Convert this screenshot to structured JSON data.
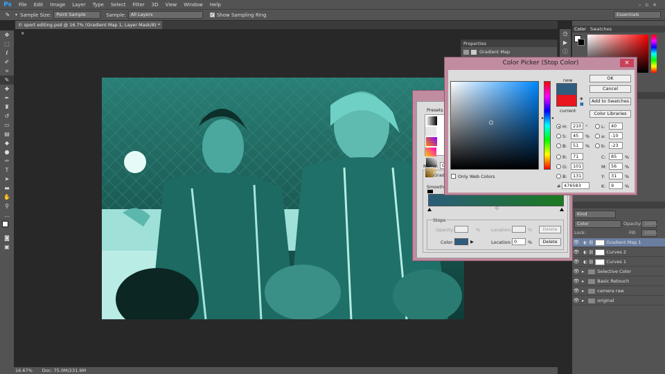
{
  "app": {
    "logo": "Ps"
  },
  "menu": [
    "File",
    "Edit",
    "Image",
    "Layer",
    "Type",
    "Select",
    "Filter",
    "3D",
    "View",
    "Window",
    "Help"
  ],
  "options": {
    "sample_size_label": "Sample Size:",
    "sample_size_value": "Point Sample",
    "sample_label": "Sample:",
    "sample_value": "All Layers",
    "show_ring_label": "Show Sampling Ring",
    "workspace": "Essentials"
  },
  "document": {
    "tab_title": "© sport editing.psd @ 16.7% (Gradient Map 1, Layer Mask/8) *",
    "close": "×"
  },
  "status": {
    "zoom": "16.67%",
    "doc": "Doc: 75.0M/231.9M"
  },
  "properties": {
    "tab": "Properties",
    "title": "Gradient Map"
  },
  "color_panel": {
    "tabs": [
      "Color",
      "Swatches"
    ]
  },
  "layers_panel": {
    "kind": "Kind",
    "blend": "Color",
    "opacity_label": "Opacity:",
    "opacity_value": "100%",
    "lock_label": "Lock:",
    "fill_label": "Fill:",
    "fill_value": "100%",
    "layers": [
      {
        "name": "Gradient Map 1",
        "type": "adjustment",
        "selected": true
      },
      {
        "name": "Curves 2",
        "type": "adjustment",
        "selected": false
      },
      {
        "name": "Curves 1",
        "type": "adjustment",
        "selected": false
      },
      {
        "name": "Selective Color",
        "type": "group",
        "selected": false
      },
      {
        "name": "Basic Retouch",
        "type": "group",
        "selected": false
      },
      {
        "name": "camera raw",
        "type": "group",
        "selected": false
      },
      {
        "name": "original",
        "type": "group",
        "selected": false
      }
    ]
  },
  "gradient_editor": {
    "presets_label": "Presets",
    "name_label": "Name:",
    "name_value": "Cu",
    "gradient_type_label": "Gradi",
    "smoothness_label": "Smoothnes",
    "stops_label": "Stops",
    "opacity_label": "Opacity:",
    "location_label": "Location:",
    "percent": "%",
    "delete_label": "Delete",
    "color_label": "Color:",
    "color_location_value": "0",
    "stop_color": "#2f5d7f",
    "gradient_start": "#2b5d7a",
    "gradient_end": "#1a7a1f"
  },
  "color_picker": {
    "title": "Color Picker (Stop Color)",
    "close": "×",
    "ok": "OK",
    "cancel": "Cancel",
    "add_swatches": "Add to Swatches",
    "color_libraries": "Color Libraries",
    "new_label": "new",
    "current_label": "current",
    "new_color": "#2f5d7f",
    "current_color": "#e8141e",
    "only_web": "Only Web Colors",
    "hex_label": "#",
    "hex": "476583",
    "fields": [
      {
        "label": "H:",
        "value": "210",
        "unit": "°"
      },
      {
        "label": "S:",
        "value": "45",
        "unit": "%"
      },
      {
        "label": "B:",
        "value": "51",
        "unit": "%"
      },
      {
        "label": "R:",
        "value": "71",
        "unit": ""
      },
      {
        "label": "G:",
        "value": "101",
        "unit": ""
      },
      {
        "label": "B:",
        "value": "131",
        "unit": ""
      }
    ],
    "lab_fields": [
      {
        "label": "L:",
        "value": "40"
      },
      {
        "label": "a:",
        "value": "-10"
      },
      {
        "label": "b:",
        "value": "-23"
      }
    ],
    "cmyk_fields": [
      {
        "label": "C:",
        "value": "85",
        "unit": "%"
      },
      {
        "label": "M:",
        "value": "56",
        "unit": "%"
      },
      {
        "label": "Y:",
        "value": "31",
        "unit": "%"
      },
      {
        "label": "K:",
        "value": "9",
        "unit": "%"
      }
    ],
    "hue": "#0088ff"
  }
}
